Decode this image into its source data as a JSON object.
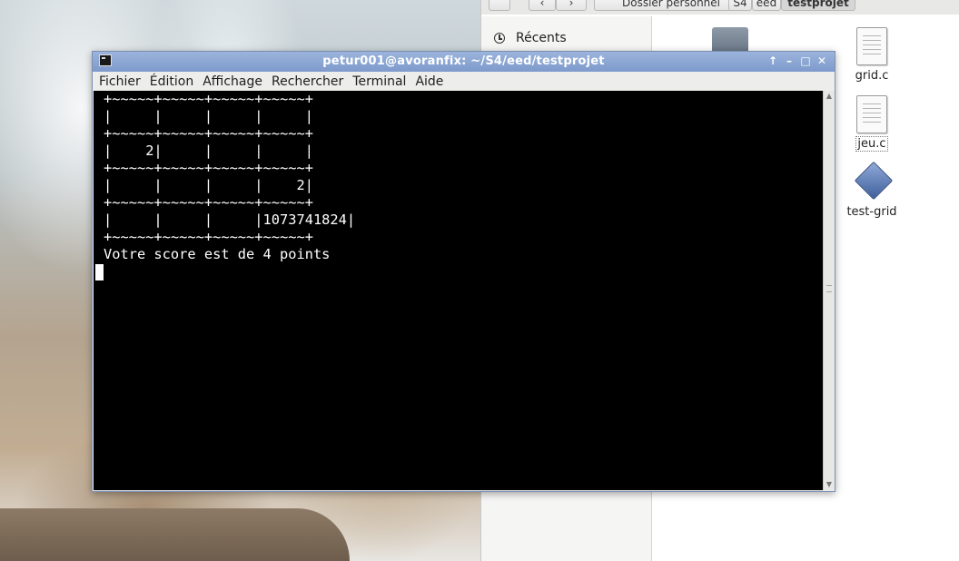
{
  "file_manager": {
    "path_buttons": [
      "Dossier personnel",
      "S4",
      "eed",
      "testprojet"
    ],
    "sidebar": {
      "recents_label": "Récents"
    },
    "files": [
      {
        "name": "grid.c",
        "icon": "c-source-file-icon"
      },
      {
        "name": "jeu.c",
        "icon": "c-source-file-icon"
      },
      {
        "name": "test-grid",
        "icon": "executable-icon"
      }
    ]
  },
  "terminal": {
    "title": "petur001@avoranfix: ~/S4/eed/testprojet",
    "menu": [
      "Fichier",
      "Édition",
      "Affichage",
      "Rechercher",
      "Terminal",
      "Aide"
    ],
    "output": "+~~~~~+~~~~~+~~~~~+~~~~~+\n|     |     |     |     |\n+~~~~~+~~~~~+~~~~~+~~~~~+\n|    2|     |     |     |\n+~~~~~+~~~~~+~~~~~+~~~~~+\n|     |     |     |    2|\n+~~~~~+~~~~~+~~~~~+~~~~~+\n|     |     |     |1073741824|\n+~~~~~+~~~~~+~~~~~+~~~~~+\nVotre score est de 4 points"
  }
}
